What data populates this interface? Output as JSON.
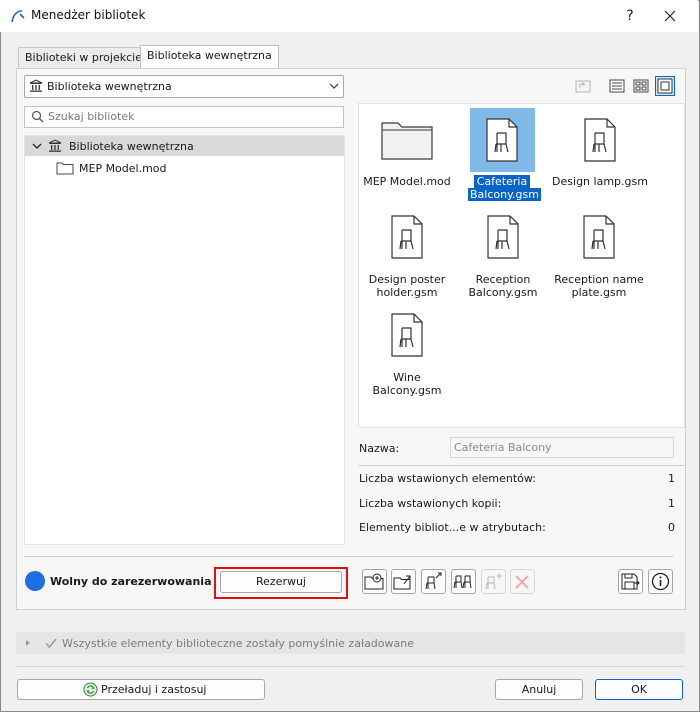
{
  "window": {
    "title": "Menedżer bibliotek",
    "help": "?"
  },
  "tabs": [
    {
      "label": "Biblioteki w projekcie",
      "active": false
    },
    {
      "label": "Biblioteka wewnętrzna",
      "active": true
    }
  ],
  "library_select": {
    "value": "Biblioteka wewnętrzna"
  },
  "search": {
    "placeholder": "Szukaj bibliotek"
  },
  "tree": {
    "root": "Biblioteka wewnętrzna",
    "children": [
      "MEP Model.mod"
    ]
  },
  "grid_items": [
    {
      "line1": "MEP Model.mod",
      "line2": "",
      "kind": "folder",
      "selected": false
    },
    {
      "line1": "Cafeteria",
      "line2": "Balcony.gsm",
      "kind": "object",
      "selected": true
    },
    {
      "line1": "Design lamp.gsm",
      "line2": "",
      "kind": "object",
      "selected": false
    },
    {
      "line1": "Design poster",
      "line2": "holder.gsm",
      "kind": "object",
      "selected": false
    },
    {
      "line1": "Reception",
      "line2": "Balcony.gsm",
      "kind": "object",
      "selected": false
    },
    {
      "line1": "Reception name",
      "line2": "plate.gsm",
      "kind": "object",
      "selected": false
    },
    {
      "line1": "Wine",
      "line2": "Balcony.gsm",
      "kind": "object",
      "selected": false
    }
  ],
  "properties": {
    "name_label": "Nazwa:",
    "name_value": "Cafeteria Balcony",
    "rows": [
      {
        "label": "Liczba wstawionych elementów:",
        "value": "1"
      },
      {
        "label": "Liczba wstawionych kopii:",
        "value": "1"
      },
      {
        "label": "Elementy bibliot...e w atrybutach:",
        "value": "0"
      }
    ]
  },
  "status": {
    "text": "Wolny do zarezerwowania",
    "color": "#1f6fe0"
  },
  "buttons": {
    "reserve": "Rezerwuj",
    "reload": "Przeładuj i zastosuj",
    "cancel": "Anuluj",
    "ok": "OK"
  },
  "message": {
    "text": "Wszystkie elementy biblioteczne zostały pomyślnie załadowane"
  },
  "colors": {
    "accent": "#0a64c6",
    "highlight": "#e01010",
    "selection": "#cfe4f7"
  }
}
